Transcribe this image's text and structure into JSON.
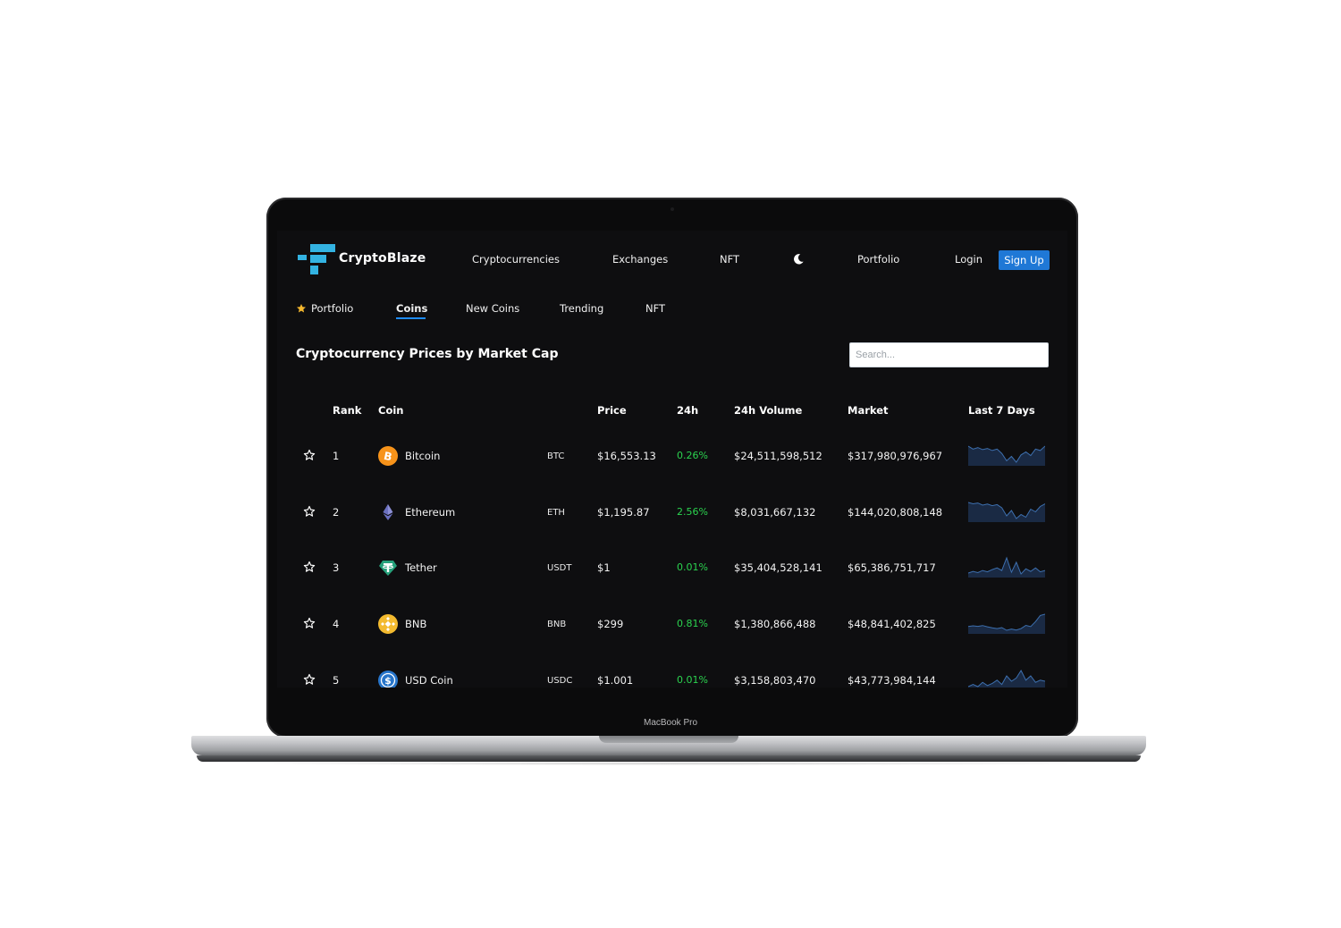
{
  "device": {
    "label": "MacBook Pro"
  },
  "app": {
    "name": "CryptoBlaze",
    "brand_color": "#33b3e2",
    "accent": "#1f78d6",
    "positive": "#2bd34f"
  },
  "topnav": {
    "cryptocurrencies": "Cryptocurrencies",
    "exchanges": "Exchanges",
    "nft": "NFT",
    "theme_icon": "moon-icon",
    "portfolio": "Portfolio",
    "login": "Login",
    "signup": "Sign Up"
  },
  "subnav": {
    "portfolio": "Portfolio",
    "coins": "Coins",
    "new_coins": "New Coins",
    "trending": "Trending",
    "nft": "NFT",
    "active": "Coins"
  },
  "main": {
    "title": "Cryptocurrency Prices by Market Cap",
    "search_placeholder": "Search..."
  },
  "table": {
    "headers": {
      "rank": "Rank",
      "coin": "Coin",
      "price": "Price",
      "change": "24h",
      "volume": "24h Volume",
      "market": "Market",
      "last7": "Last 7 Days"
    },
    "rows": [
      {
        "rank": "1",
        "name": "Bitcoin",
        "symbol": "BTC",
        "price": "$16,553.13",
        "change": "0.26%",
        "volume": "$24,511,598,512",
        "market": "$317,980,976,967",
        "icon": "bitcoin-icon",
        "trend": [
          7,
          6,
          6.5,
          5.8,
          6.2,
          5.5,
          6,
          4.5,
          2,
          3.5,
          1.5,
          4,
          5,
          3.8,
          6,
          5.5,
          7
        ]
      },
      {
        "rank": "2",
        "name": "Ethereum",
        "symbol": "ETH",
        "price": "$1,195.87",
        "change": "2.56%",
        "volume": "$8,031,667,132",
        "market": "$144,020,808,148",
        "icon": "ethereum-icon",
        "trend": [
          8,
          7.5,
          7.8,
          7,
          7.4,
          6.8,
          7.2,
          6,
          3,
          5,
          2,
          3.5,
          2.5,
          5.5,
          4.5,
          6.5,
          7.5
        ]
      },
      {
        "rank": "3",
        "name": "Tether",
        "symbol": "USDT",
        "price": "$1",
        "change": "0.01%",
        "volume": "$35,404,528,141",
        "market": "$65,386,751,717",
        "icon": "tether-icon",
        "trend": [
          4,
          4.4,
          4.1,
          4.6,
          4.3,
          4.8,
          5.2,
          4.6,
          7.5,
          4.2,
          6.5,
          3.8,
          5,
          4.4,
          5.2,
          4.3,
          4.6
        ]
      },
      {
        "rank": "4",
        "name": "BNB",
        "symbol": "BNB",
        "price": "$299",
        "change": "0.81%",
        "volume": "$1,380,866,488",
        "market": "$48,841,402,825",
        "icon": "bnb-icon",
        "trend": [
          4,
          4.3,
          4.1,
          4.4,
          3.9,
          3.5,
          3.2,
          3.6,
          2.5,
          3,
          2.6,
          3.2,
          4.5,
          4,
          6,
          8.5,
          9
        ]
      },
      {
        "rank": "5",
        "name": "USD Coin",
        "symbol": "USDC",
        "price": "$1.001",
        "change": "0.01%",
        "volume": "$3,158,803,470",
        "market": "$43,773,984,144",
        "icon": "usd-coin-icon",
        "trend": [
          5,
          5.2,
          5,
          5.4,
          5.1,
          5.3,
          5.6,
          5.2,
          6,
          5.5,
          5.8,
          6.5,
          5.6,
          6,
          5.4,
          5.6,
          5.5
        ]
      }
    ]
  }
}
